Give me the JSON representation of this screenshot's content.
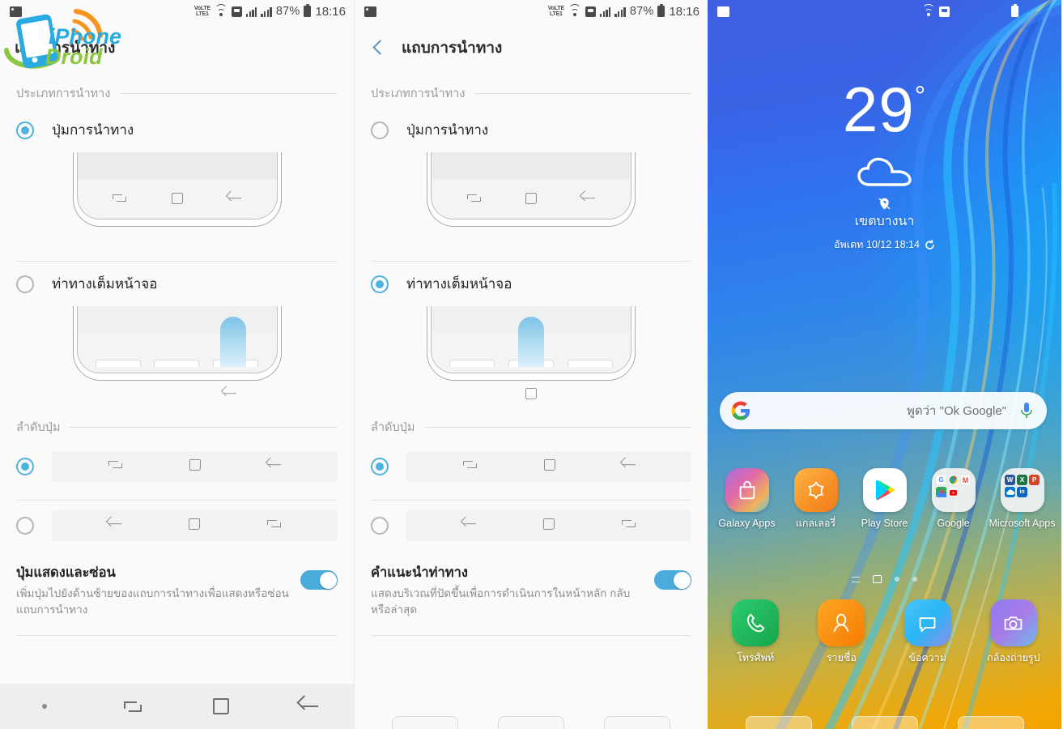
{
  "statusbar": {
    "network_label_top": "VoLTE",
    "network_label": "LTE1",
    "battery_percent": "87%",
    "time": "18:16",
    "icons": [
      "image-icon",
      "volte-icon",
      "wifi-icon",
      "sd-card-icon",
      "signal-icon",
      "signal-icon",
      "battery-icon"
    ]
  },
  "watermark": {
    "line1": "iPhone",
    "line2": "Droid"
  },
  "panel1": {
    "header": {
      "title": "แถบการนำทาง"
    },
    "section_nav_type": {
      "label": "ประเภทการนำทาง"
    },
    "options": [
      {
        "label": "ปุ่มการนำทาง",
        "selected": true
      },
      {
        "label": "ท่าทางเต็มหน้าจอ",
        "selected": false
      }
    ],
    "section_button_order": {
      "label": "ลำดับปุ่ม"
    },
    "orders": [
      {
        "icons": [
          "recents-icon",
          "home-icon",
          "back-icon"
        ],
        "selected": true
      },
      {
        "icons": [
          "back-icon",
          "home-icon",
          "recents-icon"
        ],
        "selected": false
      }
    ],
    "toggle_setting": {
      "title": "ปุ่มแสดงและซ่อน",
      "description": "เพิ่มปุ่มไปยังด้านซ้ายของแถบการนำทางเพื่อแสดงหรือซ่อนแถบการนำทาง",
      "enabled": true
    },
    "navbar": {
      "items": [
        "show-hide-dot",
        "recents-icon",
        "home-icon",
        "back-icon"
      ]
    }
  },
  "panel2": {
    "header": {
      "title": "แถบการนำทาง",
      "back": "back-chevron-icon"
    },
    "section_nav_type": {
      "label": "ประเภทการนำทาง"
    },
    "options": [
      {
        "label": "ปุ่มการนำทาง",
        "selected": false
      },
      {
        "label": "ท่าทางเต็มหน้าจอ",
        "selected": true
      }
    ],
    "section_button_order": {
      "label": "ลำดับปุ่ม"
    },
    "orders": [
      {
        "icons": [
          "recents-icon",
          "home-icon",
          "back-icon"
        ],
        "selected": true
      },
      {
        "icons": [
          "back-icon",
          "home-icon",
          "recents-icon"
        ],
        "selected": false
      }
    ],
    "toggle_setting": {
      "title": "คำแนะนำท่าทาง",
      "description": "แสดงบริเวณที่ปัดขึ้นเพื่อการดำเนินการในหน้าหลัก กลับ หรือล่าสุด",
      "enabled": true
    }
  },
  "panel3": {
    "weather": {
      "temperature": "29",
      "degree": "°",
      "condition_icon": "cloud-icon",
      "location_pin_icon": "location-pin-icon",
      "location": "เขตบางนา",
      "updated": "อัพเดท 10/12 18:14",
      "refresh_icon": "refresh-icon"
    },
    "search": {
      "logo": "google-logo-icon",
      "placeholder": "พูดว่า \"Ok Google\"",
      "mic_icon": "microphone-icon"
    },
    "apps": [
      {
        "name": "Galaxy Apps",
        "icon": "galaxy-apps-icon"
      },
      {
        "name": "แกลเลอรี่",
        "icon": "gallery-icon"
      },
      {
        "name": "Play Store",
        "icon": "play-store-icon"
      },
      {
        "name": "Google",
        "icon": "google-folder-icon"
      },
      {
        "name": "Microsoft Apps",
        "icon": "microsoft-folder-icon"
      }
    ],
    "dock": [
      {
        "name": "โทรศัพท์",
        "icon": "phone-icon"
      },
      {
        "name": "รายชื่อ",
        "icon": "contacts-icon"
      },
      {
        "name": "ข้อความ",
        "icon": "messages-icon"
      },
      {
        "name": "กล้องถ่ายรูป",
        "icon": "camera-icon"
      }
    ],
    "page_indicators": [
      "apps-page",
      "home-page",
      "page-3",
      "page-4"
    ]
  },
  "colors": {
    "accent_blue": "#4db2dd",
    "toggle_on": "#4aacdb",
    "settings_bg": "#fafafa",
    "navbar_bg": "#eeeeee"
  }
}
